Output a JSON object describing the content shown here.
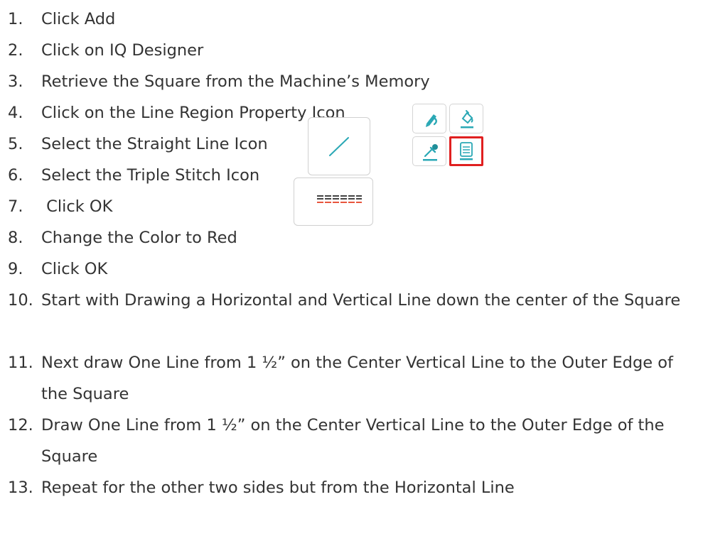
{
  "steps": [
    {
      "num": "1.",
      "text": "Click Add"
    },
    {
      "num": "2.",
      "text": "Click on IQ Designer"
    },
    {
      "num": "3.",
      "text": "Retrieve the Square from the Machine’s Memory"
    },
    {
      "num": "4.",
      "text": "Click on the Line Region Property Icon"
    },
    {
      "num": "5.",
      "text": "Select the Straight Line Icon"
    },
    {
      "num": "6.",
      "text": "Select the Triple Stitch Icon"
    },
    {
      "num": "7.",
      "text": " Click OK"
    },
    {
      "num": "8.",
      "text": "Change the Color to Red"
    },
    {
      "num": "9.",
      "text": "Click OK"
    },
    {
      "num": "10.",
      "text": "Start with Drawing a Horizontal and Vertical Line down the center of the Square"
    },
    {
      "num": "11.",
      "text": "Next draw One Line from 1 ½” on the Center Vertical Line to the Outer Edge of the Square"
    },
    {
      "num": "12.",
      "text": "Draw One Line from 1 ½” on the Center Vertical Line to the Outer Edge of the Square"
    },
    {
      "num": "13.",
      "text": "Repeat for the other two sides but from the Horizontal Line"
    }
  ],
  "icons": {
    "property_palette": [
      "pencil-line-icon",
      "fill-bucket-icon",
      "eyedropper-icon",
      "line-region-property-icon"
    ],
    "selected": "line-region-property-icon",
    "straight_line": "straight-line-icon",
    "triple_stitch": "triple-stitch-icon"
  },
  "colors": {
    "text": "#333333",
    "icon_teal": "#2aa8b5",
    "selection_red": "#e02020",
    "stitch_red": "#e8553d"
  }
}
